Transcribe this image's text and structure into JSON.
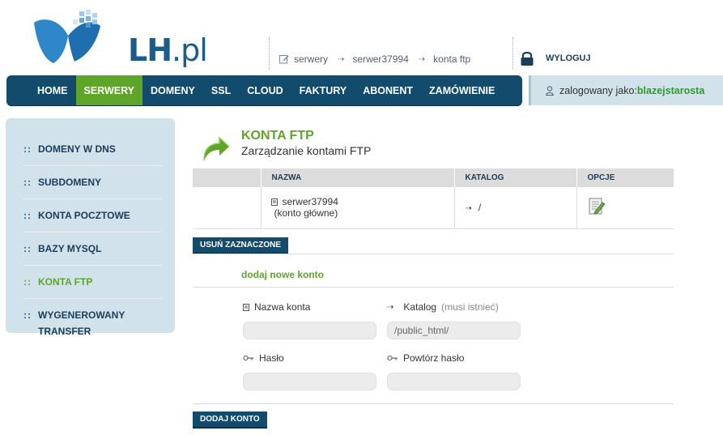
{
  "brand": {
    "logo_text": "LH",
    "logo_suffix": ".pl"
  },
  "breadcrumb": [
    "serwery",
    "serwer37994",
    "konta ftp"
  ],
  "logout_label": "WYLOGUJ",
  "nav": {
    "items": [
      "HOME",
      "SERWERY",
      "DOMENY",
      "SSL",
      "CLOUD",
      "FAKTURY",
      "ABONENT",
      "ZAMÓWIENIE"
    ],
    "active": "SERWERY"
  },
  "user": {
    "prefix": "zalogowany jako:",
    "name": "blazejstarosta"
  },
  "sidebar": {
    "bullet": "::",
    "items": [
      {
        "label": "DOMENY W DNS",
        "active": false
      },
      {
        "label": "SUBDOMENY",
        "active": false
      },
      {
        "label": "KONTA POCZTOWE",
        "active": false
      },
      {
        "label": "BAZY MYSQL",
        "active": false
      },
      {
        "label": "KONTA FTP",
        "active": true
      },
      {
        "label": "WYGENEROWANY TRANSFER",
        "active": false
      }
    ]
  },
  "page": {
    "title": "KONTA FTP",
    "subtitle": "Zarządzanie kontami FTP"
  },
  "table": {
    "headers": [
      "",
      "NAZWA",
      "KATALOG",
      "OPCJE"
    ],
    "rows": [
      {
        "name": "serwer37994",
        "note": "(konto główne)",
        "catalog": "/",
        "options_icon": "edit-document-icon"
      }
    ]
  },
  "delete_button": "USUŃ ZAZNACZONE",
  "add_form": {
    "title": "dodaj nowe konto",
    "account_name_label": "Nazwa konta",
    "catalog_label": "Katalog",
    "catalog_hint": "(musi istnieć)",
    "catalog_value": "/public_html/",
    "password_label": "Hasło",
    "repeat_password_label": "Powtórz hasło",
    "submit_label": "DODAJ KONTO"
  },
  "colors": {
    "navy": "#134b6d",
    "green": "#5fa52a",
    "light_blue": "#d2e2ea"
  }
}
